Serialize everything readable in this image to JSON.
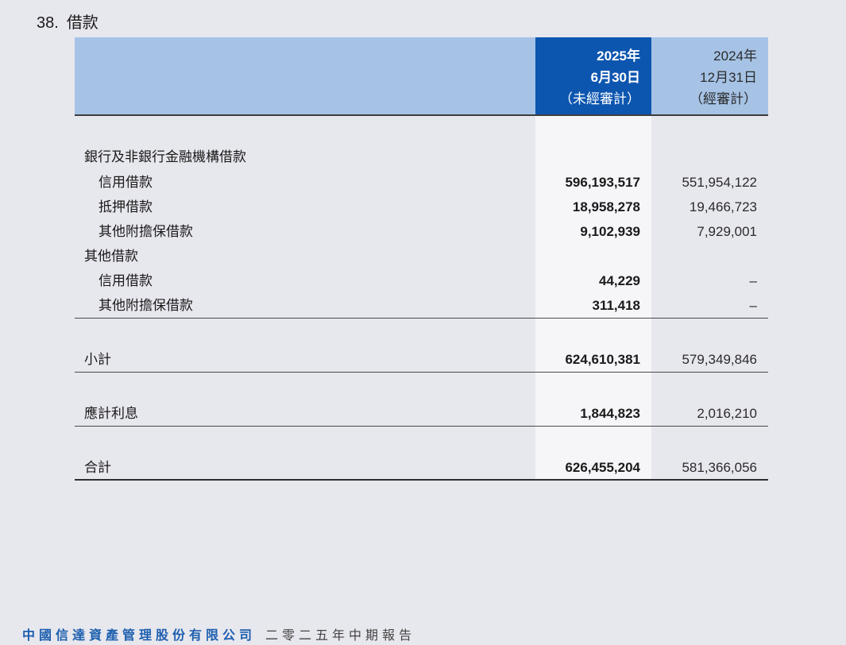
{
  "section": {
    "number": "38.",
    "title": "借款"
  },
  "header": {
    "current": {
      "line1": "2025年",
      "line2": "6月30日",
      "line3": "（未經審計）"
    },
    "previous": {
      "line1": "2024年",
      "line2": "12月31日",
      "line3": "（經審計）"
    }
  },
  "rows": [
    {
      "label": "銀行及非銀行金融機構借款",
      "cur": "",
      "prev": ""
    },
    {
      "label": "信用借款",
      "cur": "596,193,517",
      "prev": "551,954,122"
    },
    {
      "label": "抵押借款",
      "cur": "18,958,278",
      "prev": "19,466,723"
    },
    {
      "label": "其他附擔保借款",
      "cur": "9,102,939",
      "prev": "7,929,001"
    },
    {
      "label": "其他借款",
      "cur": "",
      "prev": ""
    },
    {
      "label": "信用借款",
      "cur": "44,229",
      "prev": "–"
    },
    {
      "label": "其他附擔保借款",
      "cur": "311,418",
      "prev": "–"
    }
  ],
  "subtotal": {
    "label": "小計",
    "cur": "624,610,381",
    "prev": "579,349,846"
  },
  "interest": {
    "label": "應計利息",
    "cur": "1,844,823",
    "prev": "2,016,210"
  },
  "total": {
    "label": "合計",
    "cur": "626,455,204",
    "prev": "581,366,056"
  },
  "footer": {
    "company": "中國信達資產管理股份有限公司",
    "report": "二零二五年中期報告"
  }
}
